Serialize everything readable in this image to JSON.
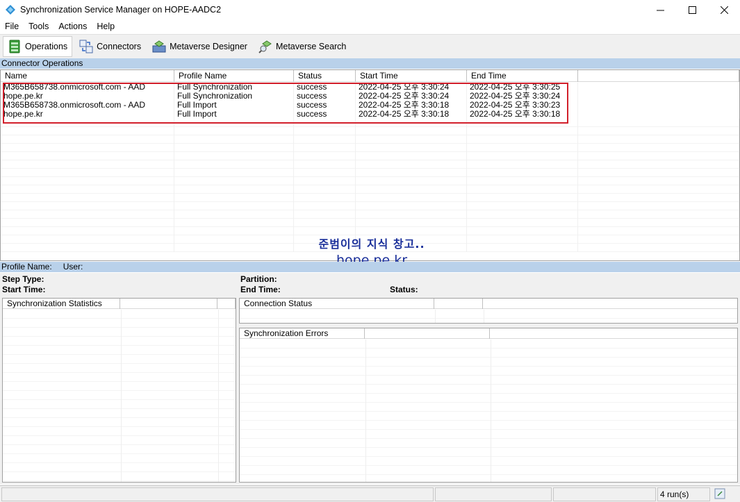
{
  "window": {
    "title": "Synchronization Service Manager on HOPE-AADC2",
    "minimize_glyph": "—",
    "maximize_glyph": "☐",
    "close_glyph": "✕"
  },
  "menu": [
    "File",
    "Tools",
    "Actions",
    "Help"
  ],
  "toolbar": {
    "operations": "Operations",
    "connectors": "Connectors",
    "metaverse_designer": "Metaverse Designer",
    "metaverse_search": "Metaverse Search"
  },
  "operations": {
    "section_title": "Connector Operations",
    "columns": [
      "Name",
      "Profile Name",
      "Status",
      "Start Time",
      "End Time"
    ],
    "rows": [
      {
        "name": "M365B658738.onmicrosoft.com - AAD",
        "profile": "Full Synchronization",
        "status": "success",
        "start": "2022-04-25 오후 3:30:24",
        "end": "2022-04-25 오후 3:30:25"
      },
      {
        "name": "hope.pe.kr",
        "profile": "Full Synchronization",
        "status": "success",
        "start": "2022-04-25 오후 3:30:24",
        "end": "2022-04-25 오후 3:30:24"
      },
      {
        "name": "M365B658738.onmicrosoft.com - AAD",
        "profile": "Full Import",
        "status": "success",
        "start": "2022-04-25 오후 3:30:18",
        "end": "2022-04-25 오후 3:30:23"
      },
      {
        "name": "hope.pe.kr",
        "profile": "Full Import",
        "status": "success",
        "start": "2022-04-25 오후 3:30:18",
        "end": "2022-04-25 오후 3:30:18"
      }
    ]
  },
  "watermark": {
    "line1": "준범이의 지식 창고..",
    "line2": "hope.pe.kr"
  },
  "details": {
    "profile_name_label": "Profile Name:",
    "user_label": "User:",
    "step_type_label": "Step Type:",
    "start_time_label": "Start Time:",
    "partition_label": "Partition:",
    "end_time_label": "End Time:",
    "status_label": "Status:",
    "sync_statistics": "Synchronization Statistics",
    "connection_status": "Connection Status",
    "sync_errors": "Synchronization Errors"
  },
  "statusbar": {
    "runs": "4 run(s)"
  },
  "colors": {
    "section_header_bg": "#b9d1ea",
    "highlight_border": "#d21f2b",
    "watermark": "#1a2f9a"
  }
}
